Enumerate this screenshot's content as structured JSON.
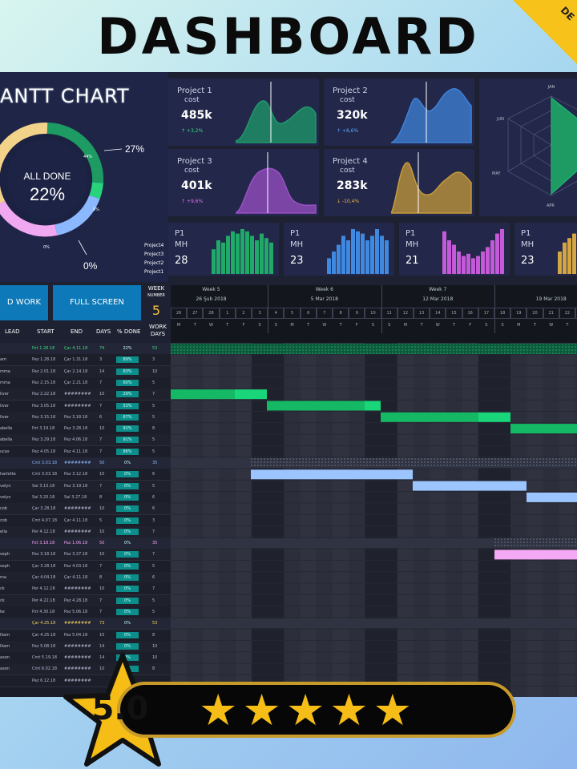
{
  "title": "DASHBOARD",
  "gantt": {
    "title": "ANTT CHART",
    "donut_center_label": "ALL DONE",
    "donut_center_value": "22%",
    "donut_callout_top": "27%",
    "donut_callout_bottom": "0%",
    "donut_small_labels": [
      "44%",
      "0%",
      "0%",
      "0%"
    ],
    "legend": [
      "Project4",
      "Project3",
      "Project2",
      "Project1"
    ]
  },
  "cost_cards": [
    {
      "title": "Project 1",
      "sub": "cost",
      "value": "485k",
      "delta": "↑ +3,2%",
      "delta_color": "#3ddc84",
      "color": "#1f9a6a"
    },
    {
      "title": "Project 2",
      "sub": "cost",
      "value": "320k",
      "delta": "↑ +8,6%",
      "delta_color": "#5aa9ff",
      "color": "#3f82d8"
    },
    {
      "title": "Project 3",
      "sub": "cost",
      "value": "401k",
      "delta": "↑ +9,6%",
      "delta_color": "#e070e8",
      "color": "#9a4fc6"
    },
    {
      "title": "Project 4",
      "sub": "cost",
      "value": "283k",
      "delta": "↓ -10,4%",
      "delta_color": "#f0b43a",
      "color": "#c69a3a"
    }
  ],
  "radar": {
    "labels": [
      "JAN",
      "JUN",
      "MAY",
      "APR"
    ]
  },
  "mh_cards": [
    {
      "title": "P1",
      "sub": "MH",
      "value": "28",
      "color": "#1faa6a"
    },
    {
      "title": "P1",
      "sub": "MH",
      "value": "23",
      "color": "#3f8ae0"
    },
    {
      "title": "P1",
      "sub": "MH",
      "value": "21",
      "color": "#c55ad8"
    },
    {
      "title": "P1",
      "sub": "MH",
      "value": "23",
      "color": "#d4a643"
    }
  ],
  "buttons": {
    "work": "D WORK",
    "fullscreen": "FULL SCREEN"
  },
  "week": {
    "label": "WEEK",
    "sublabel": "NUMBER",
    "number": "5"
  },
  "columns": [
    "LEAD",
    "START",
    "END",
    "DAYS",
    "% DONE",
    "WORK DAYS"
  ],
  "weeks": [
    {
      "name": "Week 5",
      "date": "26 Şub 2018"
    },
    {
      "name": "Week 6",
      "date": "5 Mar 2018"
    },
    {
      "name": "Week 7",
      "date": "12 Mar 2018"
    },
    {
      "name": "",
      "date": "19 Mar 2018"
    }
  ],
  "day_letters": [
    "M",
    "T",
    "W",
    "T",
    "F",
    "S",
    "S",
    "M",
    "T",
    "W",
    "T",
    "F",
    "S",
    "S",
    "M",
    "T",
    "W",
    "T",
    "F",
    "S",
    "S",
    "M",
    "T",
    "W",
    "T",
    "F"
  ],
  "day_numbers": [
    "26",
    "27",
    "28",
    "1",
    "2",
    "3",
    "4",
    "5",
    "6",
    "7",
    "8",
    "9",
    "10",
    "11",
    "12",
    "13",
    "14",
    "15",
    "16",
    "17",
    "18",
    "19",
    "20",
    "21",
    "22",
    "23"
  ],
  "rows": [
    {
      "lead": "",
      "start": "Pzt 1.28.18",
      "end": "Çar 4.11.18",
      "days": "74",
      "pct": "22%",
      "work": "53",
      "kind": "group",
      "color": "#3ddc84"
    },
    {
      "lead": "am",
      "start": "Paz 1.28.18",
      "end": "Çar 1.31.18",
      "days": "3",
      "pct": "89%",
      "work": "3"
    },
    {
      "lead": "mma",
      "start": "Paz 2.01.18",
      "end": "Çar 2.14.18",
      "days": "14",
      "pct": "83%",
      "work": "10"
    },
    {
      "lead": "mma",
      "start": "Paz 2.15.18",
      "end": "Çar 2.21.18",
      "days": "7",
      "pct": "60%",
      "work": "5"
    },
    {
      "lead": "liver",
      "start": "Paz 2.22.18",
      "end": "########",
      "days": "10",
      "pct": "29%",
      "work": "7"
    },
    {
      "lead": "liver",
      "start": "Paz 3.05.18",
      "end": "########",
      "days": "7",
      "pct": "53%",
      "work": "5"
    },
    {
      "lead": "liver",
      "start": "Paz 3.15.18",
      "end": "Paz 3.18.18",
      "days": "6",
      "pct": "67%",
      "work": "5"
    },
    {
      "lead": "abella",
      "start": "Pzt 3.19.18",
      "end": "Paz 3.28.18",
      "days": "10",
      "pct": "91%",
      "work": "8"
    },
    {
      "lead": "abella",
      "start": "Paz 3.29.18",
      "end": "Paz 4.06.18",
      "days": "7",
      "pct": "91%",
      "work": "5"
    },
    {
      "lead": "ucas",
      "start": "Paz 4.05.18",
      "end": "Paz 4.11.18",
      "days": "7",
      "pct": "86%",
      "work": "5"
    },
    {
      "lead": "",
      "start": "Cmt 3.03.18",
      "end": "########",
      "days": "50",
      "pct": "0%",
      "work": "35",
      "kind": "group",
      "color": "#8cb8ff"
    },
    {
      "lead": "harlotte",
      "start": "Cmt 3.03.18",
      "end": "Paz 3.12.18",
      "days": "10",
      "pct": "0%",
      "work": "6"
    },
    {
      "lead": "velyn",
      "start": "Sal 3.13.18",
      "end": "Paz 3.19.18",
      "days": "7",
      "pct": "0%",
      "work": "5"
    },
    {
      "lead": "velyn",
      "start": "Sal 3.20.18",
      "end": "Sal 3.27.18",
      "days": "8",
      "pct": "0%",
      "work": "6"
    },
    {
      "lead": "cob",
      "start": "Çar 3.28.18",
      "end": "########",
      "days": "10",
      "pct": "0%",
      "work": "6"
    },
    {
      "lead": "cob",
      "start": "Cmt 4.07.18",
      "end": "Çar 4.11.18",
      "days": "5",
      "pct": "0%",
      "work": "3"
    },
    {
      "lead": "elia",
      "start": "Per 4.12.18",
      "end": "########",
      "days": "10",
      "pct": "0%",
      "work": "7"
    },
    {
      "lead": "",
      "start": "Pzt 3.18.18",
      "end": "Paz 1.06.18",
      "days": "50",
      "pct": "0%",
      "work": "35",
      "kind": "group",
      "color": "#f0a0f0"
    },
    {
      "lead": "seph",
      "start": "Paz 3.18.18",
      "end": "Paz 3.27.18",
      "days": "10",
      "pct": "0%",
      "work": "7"
    },
    {
      "lead": "seph",
      "start": "Çar 3.28.18",
      "end": "Paz 4.03.18",
      "days": "7",
      "pct": "0%",
      "work": "5"
    },
    {
      "lead": "ma",
      "start": "Çar 4.04.18",
      "end": "Çar 4.11.18",
      "days": "8",
      "pct": "0%",
      "work": "6"
    },
    {
      "lead": "ck",
      "start": "Per 4.12.18",
      "end": "########",
      "days": "10",
      "pct": "0%",
      "work": "7"
    },
    {
      "lead": "ck",
      "start": "Per 4.22.18",
      "end": "Paz 4.28.18",
      "days": "7",
      "pct": "0%",
      "work": "5"
    },
    {
      "lead": "ke",
      "start": "Pzt 4.30.18",
      "end": "Paz 5.06.18",
      "days": "7",
      "pct": "0%",
      "work": "5"
    },
    {
      "lead": "",
      "start": "Çar 4.25.18",
      "end": "########",
      "days": "73",
      "pct": "0%",
      "work": "53",
      "kind": "group",
      "color": "#f5d060"
    },
    {
      "lead": "lliam",
      "start": "Çar 4.25.18",
      "end": "Paz 5.04.18",
      "days": "10",
      "pct": "0%",
      "work": "8"
    },
    {
      "lead": "lliam",
      "start": "Paz 5.08.18",
      "end": "########",
      "days": "14",
      "pct": "0%",
      "work": "10"
    },
    {
      "lead": "ason",
      "start": "Cmt 5.19.18",
      "end": "########",
      "days": "14",
      "pct": "0%",
      "work": "10"
    },
    {
      "lead": "ason",
      "start": "Cmt 6.02.18",
      "end": "########",
      "days": "10",
      "pct": "0%",
      "work": "8"
    },
    {
      "lead": "",
      "start": "Paz 6.12.18",
      "end": "########",
      "days": "",
      "pct": "",
      "work": ""
    }
  ],
  "rating": {
    "score": "5.0",
    "stars": "★★★★★"
  },
  "corner_badge": "DE"
}
